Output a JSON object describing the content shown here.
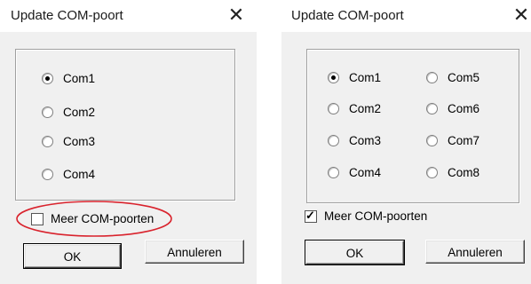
{
  "left_dialog": {
    "title": "Update COM-poort",
    "close_glyph": "✕",
    "radios": [
      {
        "label": "Com1",
        "selected": true
      },
      {
        "label": "Com2",
        "selected": false
      },
      {
        "label": "Com3",
        "selected": false
      },
      {
        "label": "Com4",
        "selected": false
      }
    ],
    "checkbox": {
      "label": "Meer COM-poorten",
      "checked": false
    },
    "ok_label": "OK",
    "cancel_label": "Annuleren",
    "annotation_color": "#d9232d"
  },
  "right_dialog": {
    "title": "Update COM-poort",
    "close_glyph": "✕",
    "radios": [
      {
        "label": "Com1",
        "selected": true
      },
      {
        "label": "Com5",
        "selected": false
      },
      {
        "label": "Com2",
        "selected": false
      },
      {
        "label": "Com6",
        "selected": false
      },
      {
        "label": "Com3",
        "selected": false
      },
      {
        "label": "Com7",
        "selected": false
      },
      {
        "label": "Com4",
        "selected": false
      },
      {
        "label": "Com8",
        "selected": false
      }
    ],
    "checkbox": {
      "label": "Meer COM-poorten",
      "checked": true
    },
    "ok_label": "OK",
    "cancel_label": "Annuleren"
  }
}
